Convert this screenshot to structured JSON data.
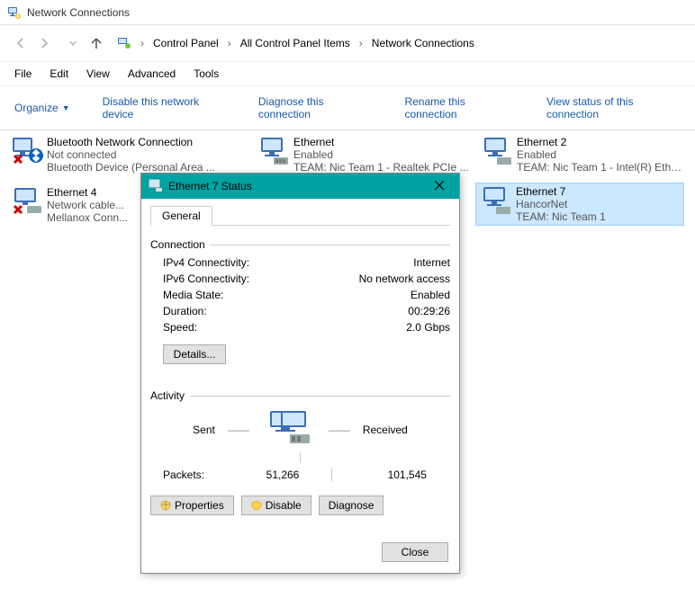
{
  "window": {
    "title": "Network Connections"
  },
  "breadcrumb": {
    "items": [
      "Control Panel",
      "All Control Panel Items",
      "Network Connections"
    ]
  },
  "menu": {
    "items": [
      "File",
      "Edit",
      "View",
      "Advanced",
      "Tools"
    ]
  },
  "toolbar": {
    "organize": "Organize",
    "disable": "Disable this network device",
    "diagnose": "Diagnose this connection",
    "rename": "Rename this connection",
    "viewstatus": "View status of this connection"
  },
  "connections": [
    {
      "name": "Bluetooth Network Connection",
      "status": "Not connected",
      "device": "Bluetooth Device (Personal Area ...",
      "error": true
    },
    {
      "name": "Ethernet",
      "status": "Enabled",
      "device": "TEAM: Nic Team 1 - Realtek PCIe ..."
    },
    {
      "name": "Ethernet 2",
      "status": "Enabled",
      "device": "TEAM: Nic Team 1 - Intel(R) Ether..."
    },
    {
      "name": "Ethernet 4",
      "status": "Network cable...",
      "device": "Mellanox Conn...",
      "error": true
    },
    {
      "name": "Ethernet 7",
      "status": "HancorNet",
      "device": "TEAM: Nic Team 1",
      "selected": true
    }
  ],
  "dialog": {
    "title": "Ethernet 7 Status",
    "tab": "General",
    "section_connection": "Connection",
    "section_activity": "Activity",
    "rows": {
      "ipv4_label": "IPv4 Connectivity:",
      "ipv4_value": "Internet",
      "ipv6_label": "IPv6 Connectivity:",
      "ipv6_value": "No network access",
      "media_label": "Media State:",
      "media_value": "Enabled",
      "duration_label": "Duration:",
      "duration_value": "00:29:26",
      "speed_label": "Speed:",
      "speed_value": "2.0 Gbps"
    },
    "details_btn": "Details...",
    "activity": {
      "sent_label": "Sent",
      "received_label": "Received",
      "packets_label": "Packets:",
      "sent": "51,266",
      "received": "101,545"
    },
    "buttons": {
      "properties": "Properties",
      "disable": "Disable",
      "diagnose": "Diagnose",
      "close": "Close"
    }
  }
}
